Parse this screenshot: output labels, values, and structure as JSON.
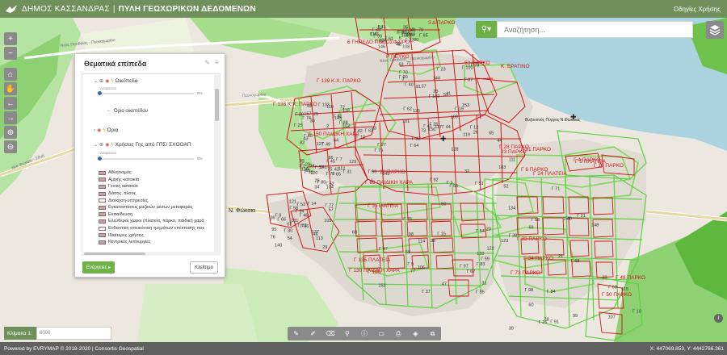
{
  "header": {
    "municipality": "ΔΗΜΟΣ ΚΑΣΣΑΝΔΡΑΣ",
    "separator": "|",
    "portal": "ΠΥΛΗ ΓΕΩΧΩΡΙΚΩΝ ΔΕΔΟΜΕΝΩΝ",
    "help": "Οδηγίες Χρήσης"
  },
  "search": {
    "placeholder": "Αναζήτηση..."
  },
  "panel": {
    "title": "Θεματικά επίπεδα",
    "layers": [
      {
        "label": "Οικόπεδα",
        "opacity_label": "Διαφάνεια",
        "opacity_pct": "0%"
      },
      {
        "label": "Όριο οικοπέδου"
      },
      {
        "label": "Όρια"
      },
      {
        "label": "Χρήσεις Γης από ΓΠΣ/ ΣΧΟΟΑΠ",
        "opacity_label": "Διαφάνεια",
        "opacity_pct": "0%"
      }
    ],
    "legend": [
      "Αθλητισμός",
      "Αμιγής κατοικία",
      "Γενική κατοικία",
      "Δάσος, άλσος",
      "Διοίκηση-υπηρεσίες",
      "Εγκαταστάσεις μαζικών μέσων μεταφοράς",
      "Εκπαίδευση",
      "Ελεύθεροι χώροι (πλατεία, πάρκο, παιδική χαρά",
      "Ενδεικτική απεικόνιση τμημάτων επέκτασης ποε",
      "Ιδιαίτερες χρήσεις",
      "Κεντρικές λειτουργίες"
    ],
    "action_button": "Ενέργειες",
    "close_button": "Κλείσιμο"
  },
  "map": {
    "roads": [
      "Νέας Ποτιδαίας - Πευκοχωρίου",
      "Νέας Ποτιδαίας - Πευκοχωρίου",
      "Νέα Φώκαια - Σάνη",
      "Πευκοχωρίου"
    ],
    "place": "Ν. Φώκαια",
    "poi": [
      "Βυζαντινός Πύργος Ν.Φώκαιας"
    ],
    "labels": [
      "3 Δ ΠΑΡΚΟ",
      "6 ΓΗΠΕΔΟ ΠΟΔΟΣΦΑΙΡΟ",
      "Ρ ΠΕΥΚΟ",
      "53 ΠΑΡΚΟ",
      "Κ. ΕΡΑΤΙΝΟ",
      "Γ 139 Κ.Χ. ΠΑΡΚΟ",
      "Γ 136 Κ.Χ. ΠΑΡΚΟ",
      "Γ 150 ΠΑΙΔΙΚΗ ΧΑΡΑ",
      "Γ 91 ΠΑΡΚΟ",
      "Γ 6 ΠΑΡΚΟ",
      "Γ 24 ΠΛΑΤΕΙΑ",
      "Γ 89 ΠΑΙΔΙΚΗ ΧΑΡΑ",
      "Γ 3 ΠΛΑΤΕΙΑ",
      "Γ 4 ΠΑΡΚΟ",
      "Γ 5 ΠΛΑΤΕΙΑ",
      "Γ 135 ΠΛΑΤΕΙΑ",
      "Γ 130 ΠΑΙΔΙΚΗ ΧΑΡΑ",
      "Γ 32 ΠΑΡΚΟ",
      "Γ 34 ΠΑΡΚΟ",
      "Γ 73 ΠΑΡΚΟ",
      "Γ 28 ΠΑΡΚΟ",
      "Γ 48 ΠΑΡΚΟ",
      "Γ 50 ΠΑΡΚΟ",
      "23 ΠΑΡΚΟ",
      "20 ΠΑΡΚΟ",
      "Γ 18 ΠΑΡΚΟ",
      "Γ 126"
    ],
    "parcel_numbers": [
      "5",
      "3",
      "2",
      "1",
      "42",
      "54",
      "50",
      "46",
      "48",
      "51",
      "49",
      "52",
      "55",
      "57",
      "59",
      "148",
      "146",
      "144",
      "145",
      "143",
      "141",
      "140",
      "152",
      "154",
      "155",
      "153",
      "157",
      "156",
      "138",
      "137",
      "20",
      "21",
      "19",
      "23",
      "25",
      "26",
      "28",
      "29",
      "31",
      "33",
      "35",
      "37",
      "30",
      "32",
      "34",
      "36",
      "38",
      "39",
      "40",
      "41",
      "43",
      "44",
      "45",
      "46",
      "47",
      "60",
      "62",
      "63",
      "64",
      "65",
      "66",
      "67",
      "68",
      "69",
      "70",
      "71",
      "72",
      "73",
      "75",
      "76",
      "77",
      "78",
      "80",
      "81",
      "82",
      "93",
      "94",
      "95",
      "98",
      "99",
      "100",
      "101",
      "102",
      "103",
      "104",
      "105",
      "106",
      "107",
      "108",
      "109",
      "110",
      "111",
      "112",
      "113",
      "114",
      "115",
      "116",
      "117",
      "118",
      "119",
      "120",
      "121",
      "122",
      "123",
      "124",
      "125",
      "127",
      "128",
      "129",
      "131",
      "133",
      "134",
      "Γ 101",
      "Γ 102",
      "Γ 103",
      "Γ 96",
      "Γ 79",
      "Γ 77",
      "Γ 76",
      "Γ 71",
      "Γ 72",
      "Γ 78",
      "Γ 81",
      "Γ 33",
      "Γ 31",
      "Γ 30",
      "Γ 35",
      "Γ 91",
      "Γ 95",
      "Γ 90",
      "Γ 85",
      "Γ 55",
      "Γ 57",
      "Γ 58",
      "Γ 59",
      "Γ 60",
      "Γ 61",
      "Γ 62",
      "Γ 63",
      "Γ 64",
      "Γ 65",
      "Γ 66",
      "Γ 67",
      "Γ 68",
      "Γ 69",
      "Γ 70",
      "Γ 49",
      "Γ 51",
      "Γ 52",
      "Γ 53",
      "Γ 54",
      "Γ 56",
      "Γ 43",
      "Γ 41",
      "Γ 42",
      "Γ 44",
      "Γ 45",
      "Γ 46",
      "Γ 47",
      "Γ 21",
      "Γ 22",
      "Γ 23",
      "Γ 25",
      "Γ 26",
      "Γ 7",
      "Γ 8",
      "Γ 9",
      "Γ 10",
      "Γ 11",
      "Γ 12",
      "Γ 13",
      "Γ 1",
      "Γ 2",
      "Γ 14",
      "Γ 15",
      "Γ 16",
      "Γ 17",
      "Γ 19",
      "Γ 20",
      "Γ 27",
      "Γ 29",
      "Γ 36",
      "Γ 37",
      "Γ 38",
      "Γ 39",
      "Γ 40",
      "Γ 74",
      "Γ 75",
      "Γ 80",
      "Γ 82",
      "Γ 83",
      "Γ 84",
      "Γ 86",
      "Γ 87",
      "Γ 88",
      "Γ 92",
      "Γ 93",
      "Γ 94",
      "Γ 97",
      "Γ 98",
      "Γ 99",
      "Γ 100"
    ]
  },
  "scale": {
    "label": "Κλίμακα 1:",
    "value": "6000"
  },
  "footer": {
    "left": "Powered by EVRYMAP © 2018-2020 | Consortis Geospatial",
    "coords": "X: 447069.853, Y: 4442766.361"
  },
  "colors": {
    "header": "#6f8f5b",
    "accent": "#6db147",
    "parcel": "#d0171b",
    "park": "#7ed957"
  }
}
